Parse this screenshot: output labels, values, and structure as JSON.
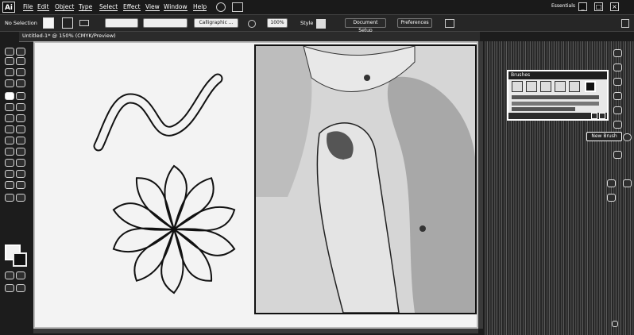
{
  "app": {
    "logo": "Ai",
    "workspace": "Essentials"
  },
  "menu": [
    "File",
    "Edit",
    "Object",
    "Type",
    "Select",
    "Effect",
    "View",
    "Window",
    "Help"
  ],
  "window_controls": {
    "minimize": "_",
    "maximize": "□",
    "close": "×"
  },
  "control_bar": {
    "selection_label": "No Selection",
    "brush_dropdown": "Calligraphic ...",
    "opacity_label": "100%",
    "style_label": "Style",
    "document_setup": "Document Setup",
    "preferences": "Preferences"
  },
  "document": {
    "tab_title": "Untitled-1* @ 150% (CMYK/Preview)"
  },
  "panel": {
    "title": "Brushes",
    "tooltip": "New Brush"
  },
  "icons": {
    "app-logo": "Ai",
    "search": "search-icon",
    "new-brush": "new-brush-icon",
    "delete": "trash-icon"
  },
  "colors": {
    "background": "#1c1c1c",
    "canvas": "#f3f3f3",
    "panel": "#e8e8e8",
    "accent": "#ffffff"
  }
}
